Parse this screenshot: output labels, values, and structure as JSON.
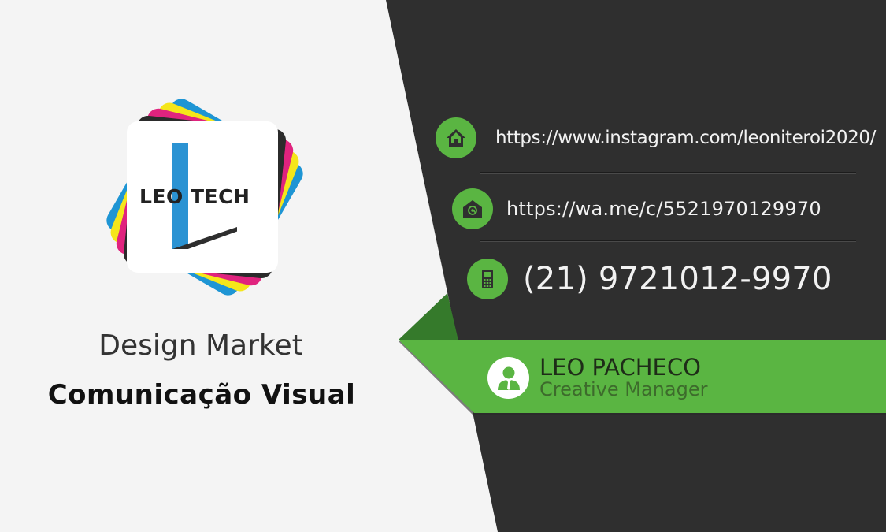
{
  "brand": {
    "logo_text": "LEO TECH",
    "tagline": "Design Market",
    "subtitle": "Comunicação Visual"
  },
  "contacts": [
    {
      "icon": "home-icon",
      "text": "https://www.instagram.com/leoniteroi2020/"
    },
    {
      "icon": "email-icon",
      "text": "https://wa.me/c/5521970129970"
    },
    {
      "icon": "phone-icon",
      "text": "(21) 9721012-9970"
    }
  ],
  "person": {
    "name": "LEO PACHECO",
    "title": "Creative Manager",
    "icon": "user-icon"
  },
  "colors": {
    "dark_panel": "#2f2f2f",
    "light_panel": "#f4f4f4",
    "accent_green": "#5ab542",
    "logo_blue": "#2b93d3",
    "logo_cyan": "#1e95d4",
    "logo_yellow": "#f5e61a",
    "logo_magenta": "#e0237e"
  }
}
